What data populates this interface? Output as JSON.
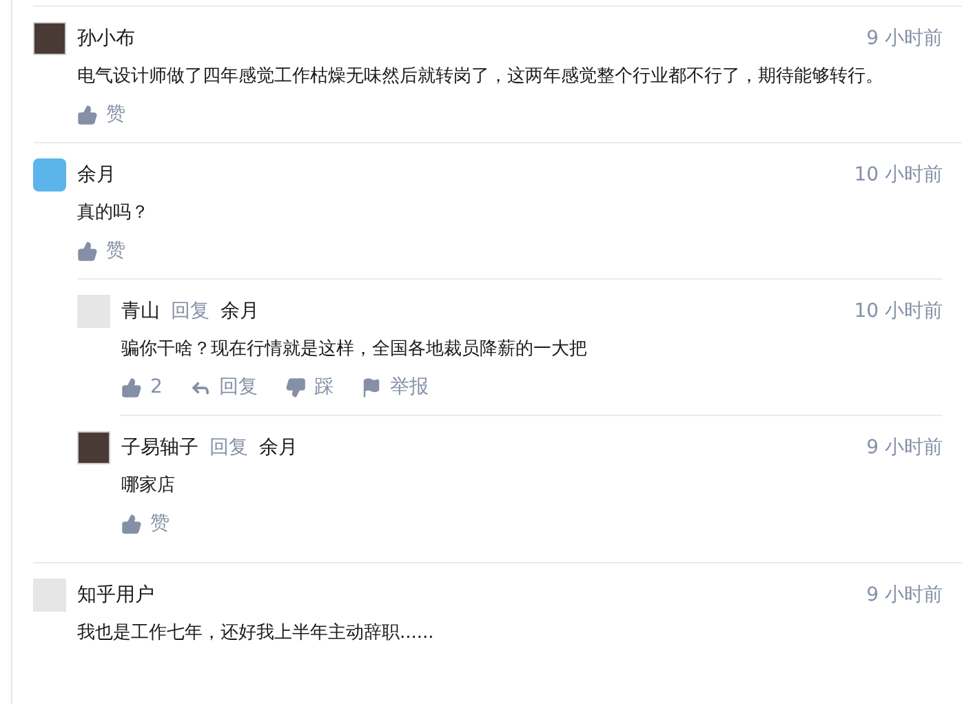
{
  "comments": [
    {
      "author": "孙小布",
      "avatar": {
        "kind": "photo"
      },
      "time": "9 小时前",
      "text": "电气设计师做了四年感觉工作枯燥无味然后就转岗了，这两年感觉整个行业都不行了，期待能够转行。",
      "actions": [
        {
          "kind": "like",
          "label": "赞"
        }
      ]
    },
    {
      "author": "余月",
      "avatar": {
        "kind": "icon"
      },
      "time": "10 小时前",
      "text": "真的吗？",
      "actions": [
        {
          "kind": "like",
          "label": "赞"
        }
      ],
      "replies": [
        {
          "author": "青山",
          "avatar": {
            "kind": "default"
          },
          "reply_word": "回复",
          "reply_to": "余月",
          "time": "10 小时前",
          "text": "骗你干啥？现在行情就是这样，全国各地裁员降薪的一大把",
          "actions": [
            {
              "kind": "like",
              "label": "2"
            },
            {
              "kind": "reply",
              "label": "回复"
            },
            {
              "kind": "dislike",
              "label": "踩"
            },
            {
              "kind": "report",
              "label": "举报"
            }
          ]
        },
        {
          "author": "子易轴子",
          "avatar": {
            "kind": "photo"
          },
          "reply_word": "回复",
          "reply_to": "余月",
          "time": "9 小时前",
          "text": "哪家店",
          "actions": [
            {
              "kind": "like",
              "label": "赞"
            }
          ]
        }
      ]
    },
    {
      "author": "知乎用户",
      "avatar": {
        "kind": "default"
      },
      "time": "9 小时前",
      "text": "我也是工作七年，还好我上半年主动辞职......"
    }
  ]
}
